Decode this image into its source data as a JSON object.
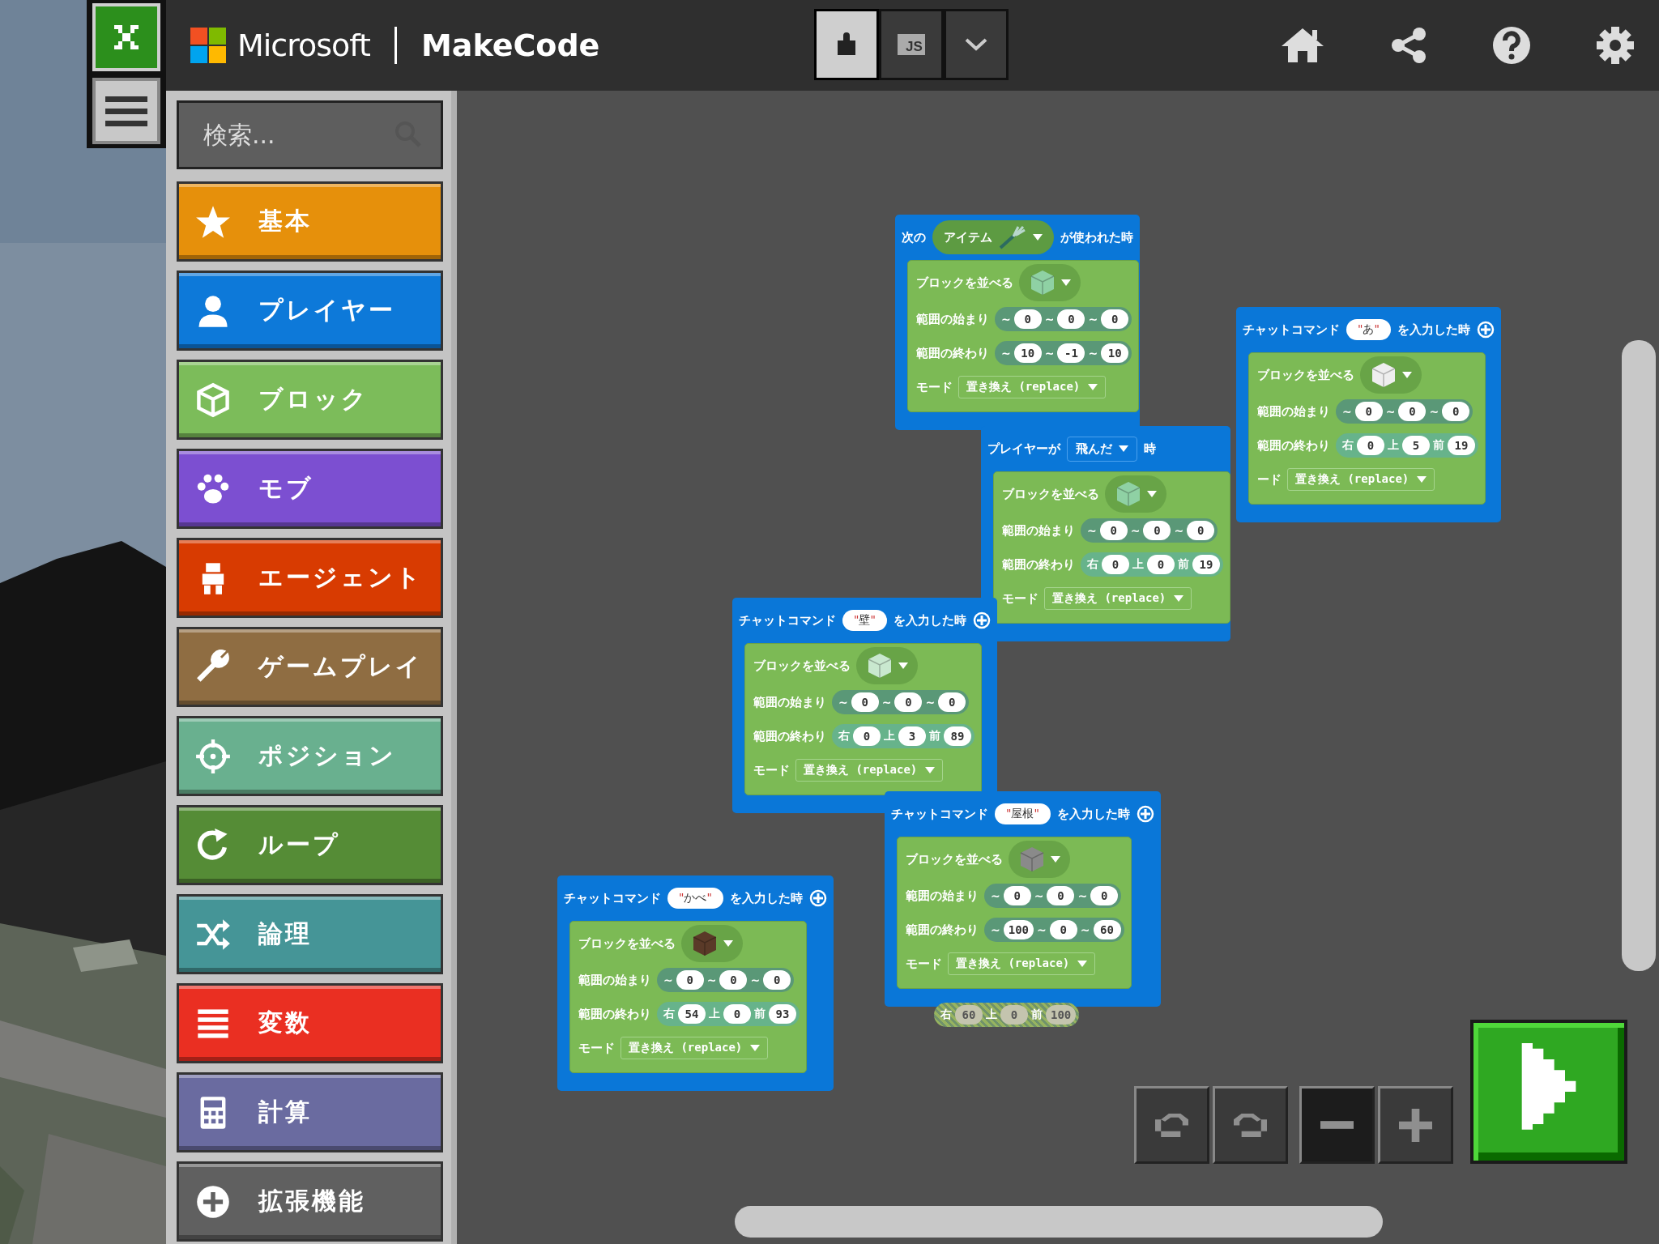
{
  "header": {
    "brand": "Microsoft",
    "product": "MakeCode",
    "editor_modes": [
      {
        "kind": "blocks",
        "selected": true
      },
      {
        "kind": "javascript",
        "label": "JS",
        "selected": false
      }
    ]
  },
  "search": {
    "placeholder": "検索..."
  },
  "categories": [
    {
      "label": "基本",
      "color": "#e6900b"
    },
    {
      "label": "プレイヤー",
      "color": "#0d79d9"
    },
    {
      "label": "ブロック",
      "color": "#7cbc5a"
    },
    {
      "label": "モブ",
      "color": "#7c4fd1"
    },
    {
      "label": "エージェント",
      "color": "#d83b01"
    },
    {
      "label": "ゲームプレイ",
      "color": "#8f6d42"
    },
    {
      "label": "ポジション",
      "color": "#69b08f"
    },
    {
      "label": "ループ",
      "color": "#558c36"
    },
    {
      "label": "論理",
      "color": "#459597"
    },
    {
      "label": "変数",
      "color": "#ea2f22"
    },
    {
      "label": "計算",
      "color": "#6a6ba0"
    },
    {
      "label": "拡張機能",
      "color": "#606060"
    }
  ],
  "blocks": [
    {
      "hat": [
        {
          "kind": "label",
          "text": "次の"
        },
        {
          "kind": "item",
          "text": "アイテム"
        },
        {
          "kind": "label",
          "text": "が使われた時"
        }
      ],
      "body": {
        "label": "ブロックを並べる",
        "color": "#8fd1a4",
        "rows": [
          {
            "label": "範囲の始まり",
            "kind": "world",
            "coords": [
              {
                "axis": "~",
                "value": "0"
              },
              {
                "axis": "~",
                "value": "0"
              },
              {
                "axis": "~",
                "value": "0"
              }
            ]
          },
          {
            "label": "範囲の終わり",
            "kind": "world",
            "coords": [
              {
                "axis": "~",
                "value": "10"
              },
              {
                "axis": "~",
                "value": "-1"
              },
              {
                "axis": "~",
                "value": "10"
              }
            ]
          }
        ],
        "mode_label": "モード",
        "mode": "置き換え (replace)"
      }
    },
    {
      "hat": [
        {
          "kind": "label",
          "text": "チャットコマンド"
        },
        {
          "kind": "string",
          "quote": "\"",
          "text": "あ"
        },
        {
          "kind": "label",
          "text": "を入力した時"
        },
        {
          "kind": "add"
        }
      ],
      "body": {
        "label": "ブロックを並べる",
        "color": "#eeeeee",
        "rows": [
          {
            "label": "範囲の始まり",
            "kind": "world",
            "coords": [
              {
                "axis": "~",
                "value": "0"
              },
              {
                "axis": "~",
                "value": "0"
              },
              {
                "axis": "~",
                "value": "0"
              }
            ]
          },
          {
            "label": "範囲の終わり",
            "kind": "local",
            "coords": [
              {
                "axis": "右",
                "value": "0"
              },
              {
                "axis": "上",
                "value": "5"
              },
              {
                "axis": "前",
                "value": "19"
              }
            ]
          }
        ],
        "mode_label": "ード",
        "mode": "置き換え (replace)"
      }
    },
    {
      "hat": [
        {
          "kind": "label",
          "text": "プレイヤーが"
        },
        {
          "kind": "event",
          "text": "飛んだ"
        },
        {
          "kind": "label",
          "text": "時"
        }
      ],
      "body": {
        "label": "ブロックを並べる",
        "color": "#8fd1a4",
        "rows": [
          {
            "label": "範囲の始まり",
            "kind": "world",
            "coords": [
              {
                "axis": "~",
                "value": "0"
              },
              {
                "axis": "~",
                "value": "0"
              },
              {
                "axis": "~",
                "value": "0"
              }
            ]
          },
          {
            "label": "範囲の終わり",
            "kind": "local",
            "coords": [
              {
                "axis": "右",
                "value": "0"
              },
              {
                "axis": "上",
                "value": "0"
              },
              {
                "axis": "前",
                "value": "19"
              }
            ]
          }
        ],
        "mode_label": "モード",
        "mode": "置き換え (replace)"
      }
    },
    {
      "hat": [
        {
          "kind": "label",
          "text": "チャットコマンド"
        },
        {
          "kind": "string",
          "quote": "\"",
          "text": "壁"
        },
        {
          "kind": "label",
          "text": "を入力した時"
        },
        {
          "kind": "add"
        }
      ],
      "body": {
        "label": "ブロックを並べる",
        "color": "#c9e8cf",
        "rows": [
          {
            "label": "範囲の始まり",
            "kind": "world",
            "coords": [
              {
                "axis": "~",
                "value": "0"
              },
              {
                "axis": "~",
                "value": "0"
              },
              {
                "axis": "~",
                "value": "0"
              }
            ]
          },
          {
            "label": "範囲の終わり",
            "kind": "local",
            "coords": [
              {
                "axis": "右",
                "value": "0"
              },
              {
                "axis": "上",
                "value": "3"
              },
              {
                "axis": "前",
                "value": "89"
              }
            ]
          }
        ],
        "mode_label": "モード",
        "mode": "置き換え (replace)"
      }
    },
    {
      "hat": [
        {
          "kind": "label",
          "text": "チャットコマンド"
        },
        {
          "kind": "string",
          "quote": "\"",
          "text": "屋根"
        },
        {
          "kind": "label",
          "text": "を入力した時"
        },
        {
          "kind": "add"
        }
      ],
      "body": {
        "label": "ブロックを並べる",
        "color": "#8a8a8a",
        "rows": [
          {
            "label": "範囲の始まり",
            "kind": "world",
            "coords": [
              {
                "axis": "~",
                "value": "0"
              },
              {
                "axis": "~",
                "value": "0"
              },
              {
                "axis": "~",
                "value": "0"
              }
            ]
          },
          {
            "label": "範囲の終わり",
            "kind": "world",
            "coords": [
              {
                "axis": "~",
                "value": "100"
              },
              {
                "axis": "~",
                "value": "0"
              },
              {
                "axis": "~",
                "value": "60"
              }
            ]
          }
        ],
        "mode_label": "モード",
        "mode": "置き換え (replace)"
      }
    },
    {
      "hat": [
        {
          "kind": "label",
          "text": "チャットコマンド"
        },
        {
          "kind": "string",
          "quote": "\"",
          "text": "かべ"
        },
        {
          "kind": "label",
          "text": "を入力した時"
        },
        {
          "kind": "add"
        }
      ],
      "body": {
        "label": "ブロックを並べる",
        "color": "#5a3a28",
        "rows": [
          {
            "label": "範囲の始まり",
            "kind": "world",
            "coords": [
              {
                "axis": "~",
                "value": "0"
              },
              {
                "axis": "~",
                "value": "0"
              },
              {
                "axis": "~",
                "value": "0"
              }
            ]
          },
          {
            "label": "範囲の終わり",
            "kind": "local",
            "coords": [
              {
                "axis": "右",
                "value": "54"
              },
              {
                "axis": "上",
                "value": "0"
              },
              {
                "axis": "前",
                "value": "93"
              }
            ]
          }
        ],
        "mode_label": "モード",
        "mode": "置き換え (replace)"
      }
    }
  ],
  "loose_reporter": {
    "kind": "local",
    "disabled": true,
    "coords": [
      {
        "axis": "右",
        "value": "60"
      },
      {
        "axis": "上",
        "value": "0"
      },
      {
        "axis": "前",
        "value": "100"
      }
    ]
  },
  "tools": [
    {
      "kind": "undo",
      "pressed": false
    },
    {
      "kind": "redo",
      "pressed": false
    },
    {
      "kind": "zoom-out",
      "pressed": true
    },
    {
      "kind": "zoom-in",
      "pressed": false
    }
  ]
}
